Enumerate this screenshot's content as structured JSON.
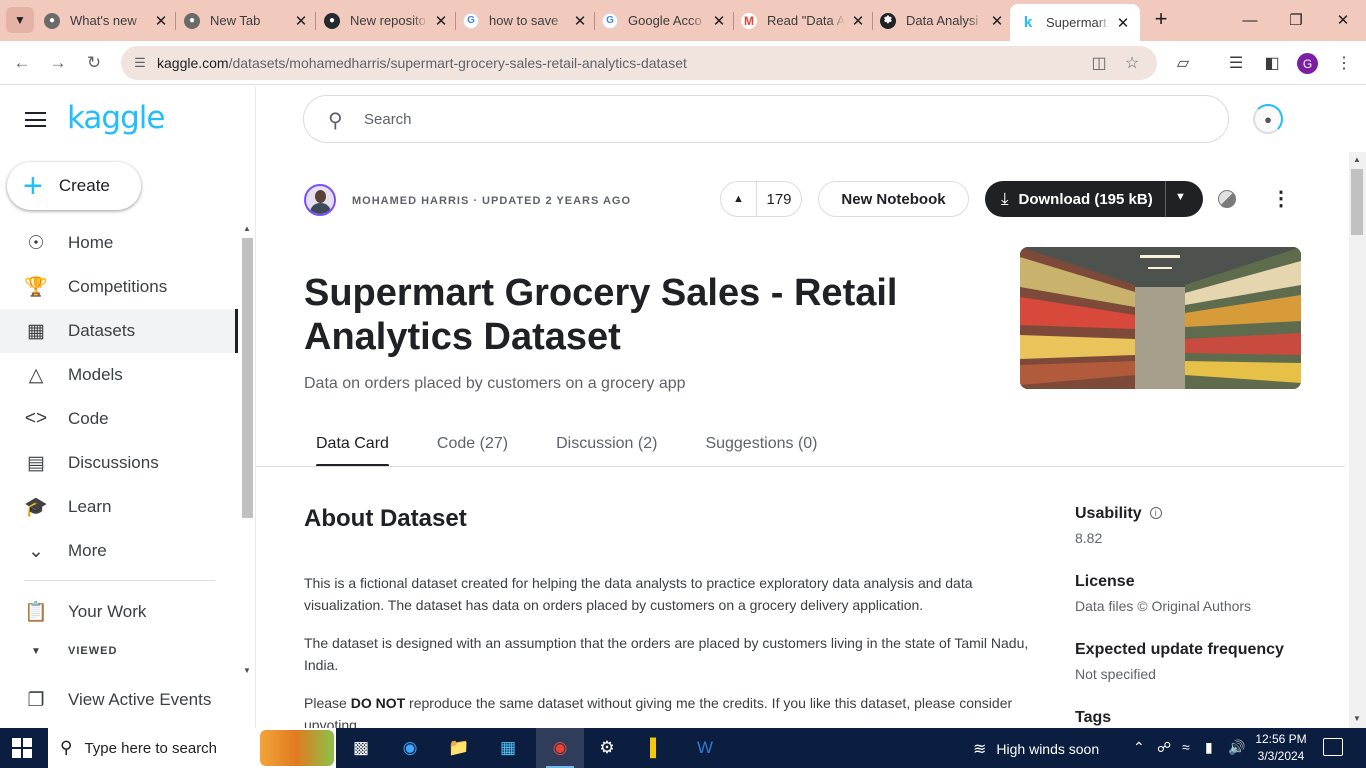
{
  "browser": {
    "tabs": [
      {
        "title": "What's new",
        "favicon": "github-icon"
      },
      {
        "title": "New Tab",
        "favicon": "github-icon"
      },
      {
        "title": "New reposito",
        "favicon": "github-icon"
      },
      {
        "title": "how to save",
        "favicon": "google-icon"
      },
      {
        "title": "Google Acco",
        "favicon": "google-icon"
      },
      {
        "title": "Read \"Data A",
        "favicon": "gmail-icon"
      },
      {
        "title": "Data Analysi",
        "favicon": "openai-icon"
      },
      {
        "title": "Supermart G",
        "favicon": "kaggle-icon",
        "active": true
      }
    ],
    "url_host": "kaggle.com",
    "url_path": "/datasets/mohamedharris/supermart-grocery-sales-retail-analytics-dataset",
    "profile_initial": "G"
  },
  "sidebar": {
    "logo": "kaggle",
    "create_label": "Create",
    "items": [
      {
        "label": "Home",
        "icon": "compass-icon"
      },
      {
        "label": "Competitions",
        "icon": "trophy-icon"
      },
      {
        "label": "Datasets",
        "icon": "table-icon",
        "active": true
      },
      {
        "label": "Models",
        "icon": "models-icon"
      },
      {
        "label": "Code",
        "icon": "code-icon"
      },
      {
        "label": "Discussions",
        "icon": "discussion-icon"
      },
      {
        "label": "Learn",
        "icon": "graduation-cap-icon"
      },
      {
        "label": "More",
        "icon": "chevron-down-icon"
      }
    ],
    "your_work": "Your Work",
    "viewed": "VIEWED",
    "view_active_events": "View Active Events"
  },
  "header": {
    "search_placeholder": "Search"
  },
  "dataset": {
    "author_meta": "MOHAMED HARRIS · UPDATED 2 YEARS AGO",
    "votes": "179",
    "new_notebook": "New Notebook",
    "download": "Download (195 kB)",
    "title": "Supermart Grocery Sales - Retail Analytics Dataset",
    "subtitle": "Data on orders placed by customers on a grocery app",
    "tabs": [
      "Data Card",
      "Code (27)",
      "Discussion (2)",
      "Suggestions (0)"
    ],
    "about_heading": "About Dataset",
    "para1": "This is a fictional dataset created for helping the data analysts to practice exploratory data analysis and data visualization. The dataset has data on orders placed by customers on a grocery delivery application.",
    "para2": "The dataset is designed with an assumption that the orders are placed by customers living in the state of Tamil Nadu, India.",
    "para3_pre": "Please ",
    "para3_bold": "DO NOT",
    "para3_post": " reproduce the same dataset without giving me the credits. If you like this dataset, please consider upvoting."
  },
  "meta": {
    "usability_label": "Usability",
    "usability_value": "8.82",
    "license_label": "License",
    "license_value": "Data files © Original Authors",
    "update_label": "Expected update frequency",
    "update_value": "Not specified",
    "tags_label": "Tags"
  },
  "taskbar": {
    "search_placeholder": "Type here to search",
    "weather": "High winds soon",
    "time": "12:56 PM",
    "date": "3/3/2024"
  }
}
